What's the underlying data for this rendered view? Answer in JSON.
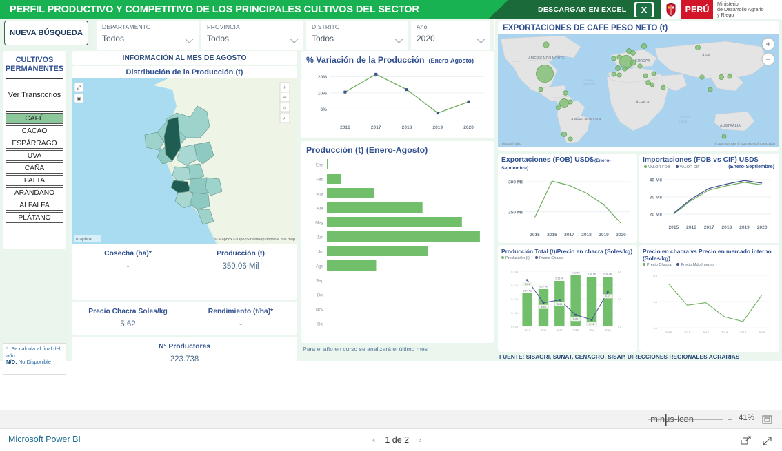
{
  "header": {
    "title": "PERFIL PRODUCTIVO Y COMPETITIVO DE LOS PRINCIPALES CULTIVOS DEL SECTOR",
    "download_label": "DESCARGAR EN EXCEL",
    "excel_icon": "excel-icon",
    "peru_label": "PERÚ",
    "ministry_line1": "Ministerio",
    "ministry_line2": "de Desarrollo Agrario",
    "ministry_line3": "y Riego",
    "brand_green": "#18b252",
    "brand_dark_green": "#1b6b3a",
    "brand_red": "#d3152a"
  },
  "filters": [
    {
      "label": "DEPARTAMENTO",
      "value": "Todos"
    },
    {
      "label": "PROVINCIA",
      "value": "Todos"
    },
    {
      "label": "DISTRITO",
      "value": "Todos"
    },
    {
      "label": "Año",
      "value": "2020"
    }
  ],
  "sidebar": {
    "new_search": "NUEVA BÚSQUEDA",
    "group_title_l1": "CULTIVOS",
    "group_title_l2": "PERMANENTES",
    "toggle_label": "Ver Transitorios",
    "crops": [
      {
        "label": "CAFÉ",
        "selected": true
      },
      {
        "label": "CACAO",
        "selected": false
      },
      {
        "label": "ESPÁRRAGO",
        "selected": false
      },
      {
        "label": "UVA",
        "selected": false
      },
      {
        "label": "CAÑA",
        "selected": false
      },
      {
        "label": "PALTA",
        "selected": false
      },
      {
        "label": "ARÁNDANO",
        "selected": false
      },
      {
        "label": "ALFALFA",
        "selected": false
      },
      {
        "label": "PLÁTANO",
        "selected": false
      }
    ],
    "note_line1": "*: Se calcula al final del año",
    "note_bold": "N/D:",
    "note_line2": " No Disponible"
  },
  "center": {
    "info_band": "INFORMACIÓN AL MES DE AGOSTO",
    "map_title": "Distribución de la Producción (t)",
    "map_attribution": "mapbox",
    "map_credit": "© Mapbox © OpenStreetMap  Improve this map",
    "kpis": [
      {
        "label": "Cosecha (ha)*",
        "value": "-"
      },
      {
        "label": "Producción (t)",
        "value": "359,06 Mil"
      },
      {
        "label": "Precio Chacra Soles/kg",
        "value": "5,62"
      },
      {
        "label": "Rendimiento (t/ha)*",
        "value": "-"
      },
      {
        "label": "N° Productores",
        "value": "223.738"
      }
    ]
  },
  "middle": {
    "footnote": "Para el año en curso se analizará el último mes"
  },
  "right": {
    "world_map_title": "EXPORTACIONES DE CAFE PESO NETO (t)",
    "map_regions": [
      "AMÉRICA DO NORTE",
      "AMÉRICA DO SUL",
      "EUROPA",
      "ÁFRICA",
      "ÁSIA",
      "AUSTRÁLIA",
      "Oceano Atlântico",
      "Oceano Índico"
    ],
    "map_credit": "© 2020 TomTom, © 2020 Microsoft Corporation",
    "zoom_in_icon": "plus-icon",
    "zoom_out_icon": "minus-icon",
    "source": "FUENTE: SISAGRI, SUNAT, CENAGRO, SISAP, DIRECCIONES REGIONALES AGRARIAS"
  },
  "footer": {
    "powerbi_label": "Microsoft Power BI",
    "page_label": "1 de 2",
    "prev_icon": "chevron-left-icon",
    "next_icon": "chevron-right-icon",
    "zoom_level": "41%",
    "zoom_out_icon": "minus-icon",
    "zoom_in_icon": "plus-icon",
    "fit_icon": "fit-to-page-icon",
    "share_icon": "share-icon",
    "fullscreen_icon": "fullscreen-icon"
  },
  "chart_data": [
    {
      "id": "variacion",
      "type": "line",
      "title": "% Variación de la Producción",
      "subtitle": "(Enero-Agosto)",
      "categories": [
        "2016",
        "2017",
        "2018",
        "2019",
        "2020"
      ],
      "values": [
        10.5,
        21.5,
        12.0,
        -2.5,
        4.5
      ],
      "ylabel": "",
      "xlabel": "",
      "ytick_labels": [
        "0%",
        "10%",
        "20%"
      ],
      "ytick_values": [
        0,
        10,
        20
      ],
      "ylim": [
        -5,
        24
      ],
      "grid": true,
      "line_color": "#6fae5e",
      "marker_color": "#3b4f8a",
      "legend": "none"
    },
    {
      "id": "produccion_mensual",
      "type": "bar",
      "orientation": "horizontal",
      "title": "Producción (t) (Enero-Agosto)",
      "categories": [
        "Ene",
        "Feb",
        "Mar",
        "Abr",
        "May",
        "Jun",
        "Jul",
        "Ago",
        "Sep",
        "Oct",
        "Nov",
        "Dic"
      ],
      "values": [
        0.6,
        12.5,
        40.5,
        82.5,
        116.5,
        132.0,
        87.0,
        42.5,
        0,
        0,
        0,
        0
      ],
      "xlim": [
        0,
        138
      ],
      "bar_color": "#71bf6a",
      "grid": false,
      "legend": "none"
    },
    {
      "id": "exportaciones_fob",
      "type": "line",
      "title": "Exportaciones (FOB) USD$",
      "subtitle": "(Enero-Septiembre)",
      "categories": [
        "2015",
        "2016",
        "2017",
        "2018",
        "2019",
        "2020"
      ],
      "values": [
        241,
        301,
        294,
        281,
        262,
        231
      ],
      "ytick_labels": [
        "250 Mil",
        "300 Mil"
      ],
      "ytick_values": [
        250,
        300
      ],
      "ylim": [
        228,
        308
      ],
      "grid": true,
      "line_color": "#6fae5e",
      "legend": "none"
    },
    {
      "id": "importaciones_fob_cif",
      "type": "line",
      "title": "Importaciones (FOB vs CIF) USD$",
      "subtitle": "(Enero-Septiembre)",
      "categories": [
        "2015",
        "2016",
        "2017",
        "2018",
        "2019",
        "2020"
      ],
      "series": [
        {
          "name": "VALOR FOB",
          "values": [
            20.0,
            28.0,
            34.0,
            36.5,
            38.5,
            37.0
          ],
          "color": "#6fae5e"
        },
        {
          "name": "VALOR CIF",
          "values": [
            20.5,
            28.8,
            35.0,
            37.5,
            39.5,
            38.0
          ],
          "color": "#46518f"
        }
      ],
      "ytick_labels": [
        "20 Mil",
        "30 Mil",
        "40 Mil"
      ],
      "ytick_values": [
        20,
        30,
        40
      ],
      "ylim": [
        18,
        42
      ],
      "grid": true,
      "legend": "top"
    },
    {
      "id": "produccion_total_precio_chacra",
      "type": "bar",
      "title": "Producción Total (t)/Precio en chacra (Soles/kg)",
      "categories": [
        "2015",
        "2016",
        "2017",
        "2018",
        "2019",
        "2020"
      ],
      "series": [
        {
          "name": "Producción (t)",
          "kind": "bar",
          "color": "#71bf6a",
          "values": [
            0.24,
            0.27,
            0.33,
            0.37,
            0.36,
            0.36
          ],
          "labels": [
            "0,24 Mi",
            "0,27 Mi",
            "0,33 Mi",
            "0,37 Mi",
            "0,36 Mi",
            "0,36 Mi"
          ]
        },
        {
          "name": "Precio Chacra",
          "kind": "line",
          "color": "#46518f",
          "values": [
            5.84,
            5.43,
            5.48,
            5.21,
            5.12,
            5.62
          ],
          "labels": [
            "5,84",
            "5,43",
            "5,48",
            "5,21",
            "5,12",
            "5,62"
          ]
        }
      ],
      "y_left_labels": [
        "0,0 Mi",
        "0,1 Mi",
        "0,2 Mi",
        "0,3 Mi",
        "0,4 Mi"
      ],
      "y_left_values": [
        0.0,
        0.1,
        0.2,
        0.3,
        0.4
      ],
      "y_right_labels": [
        "5,0",
        "5,5",
        "6,0"
      ],
      "y_right_values": [
        5.0,
        5.5,
        6.0
      ],
      "legend": "top"
    },
    {
      "id": "precio_chacra_vs_mercado",
      "type": "line",
      "title": "Precio en chacra vs Precio en mercado interno (Soles/kg)",
      "categories": [
        "2015",
        "2016",
        "2017",
        "2018",
        "2019",
        "2020"
      ],
      "series": [
        {
          "name": "Precio Chacra",
          "values": [
            5.84,
            5.43,
            5.48,
            5.21,
            5.12,
            5.62
          ],
          "color": "#6fae5e"
        },
        {
          "name": "Precio Mdo Interno",
          "values": [
            null,
            null,
            null,
            null,
            null,
            null
          ],
          "color": "#46518f"
        }
      ],
      "ytick_labels": [
        "5,0",
        "5,5",
        "6,0"
      ],
      "ytick_values": [
        5.0,
        5.5,
        6.0
      ],
      "ylim": [
        5.0,
        6.0
      ],
      "grid": true,
      "legend": "top"
    }
  ]
}
